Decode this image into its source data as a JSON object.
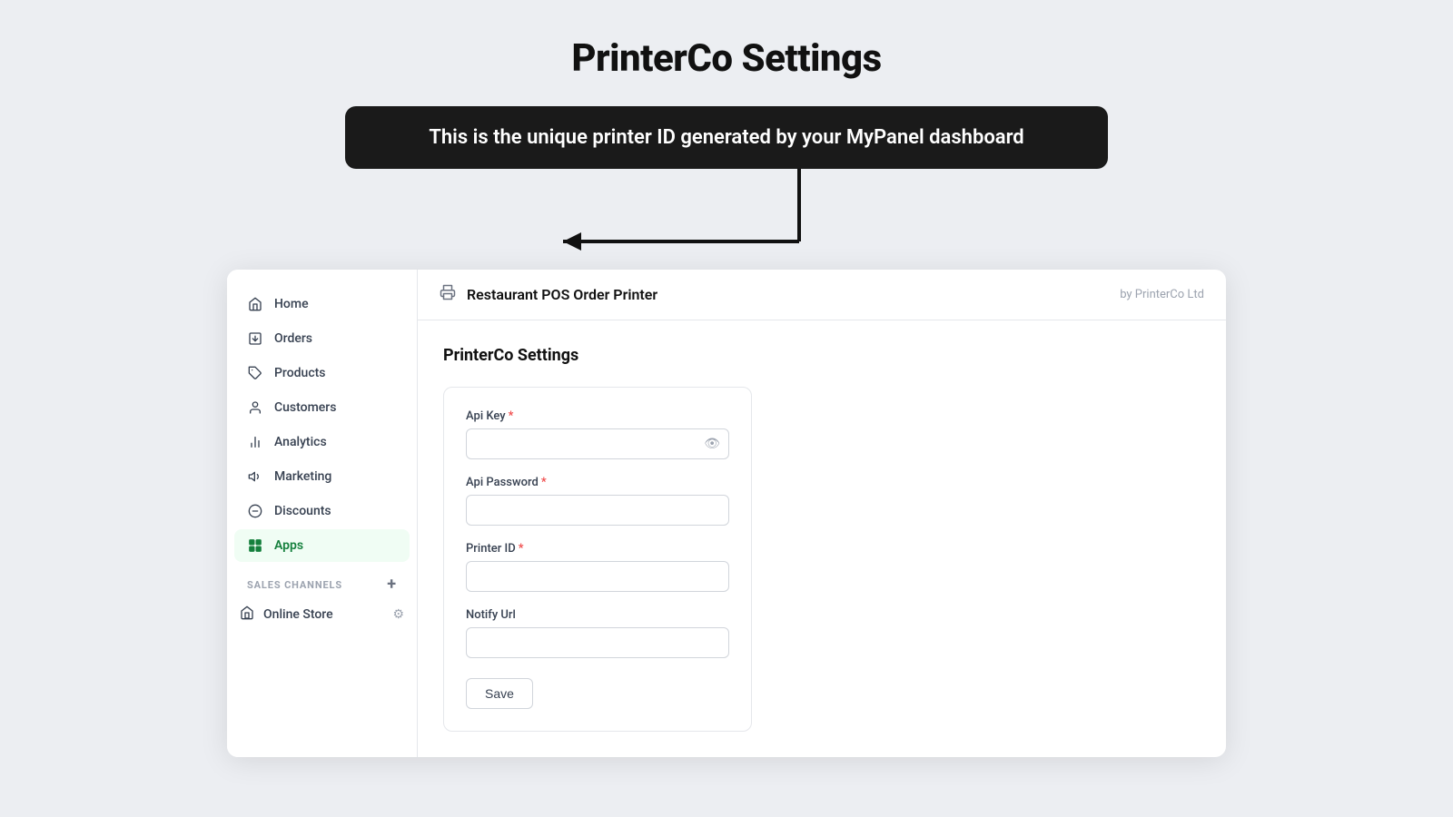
{
  "page": {
    "title": "PrinterCo Settings",
    "tooltip": "This is the unique printer ID generated by your MyPanel dashboard"
  },
  "sidebar": {
    "nav_items": [
      {
        "id": "home",
        "label": "Home",
        "icon": "home"
      },
      {
        "id": "orders",
        "label": "Orders",
        "icon": "orders"
      },
      {
        "id": "products",
        "label": "Products",
        "icon": "products"
      },
      {
        "id": "customers",
        "label": "Customers",
        "icon": "customers"
      },
      {
        "id": "analytics",
        "label": "Analytics",
        "icon": "analytics"
      },
      {
        "id": "marketing",
        "label": "Marketing",
        "icon": "marketing"
      },
      {
        "id": "discounts",
        "label": "Discounts",
        "icon": "discounts"
      },
      {
        "id": "apps",
        "label": "Apps",
        "icon": "apps",
        "active": true
      }
    ],
    "channels_label": "SALES CHANNELS",
    "channels": [
      {
        "id": "online-store",
        "label": "Online Store",
        "icon": "store"
      }
    ]
  },
  "top_bar": {
    "icon": "printer",
    "title": "Restaurant POS Order Printer",
    "by_label": "by PrinterCo Ltd"
  },
  "form": {
    "title": "PrinterCo Settings",
    "fields": [
      {
        "id": "api-key",
        "label": "Api Key",
        "required": true,
        "type": "password",
        "placeholder": ""
      },
      {
        "id": "api-password",
        "label": "Api Password",
        "required": true,
        "type": "password",
        "placeholder": ""
      },
      {
        "id": "printer-id",
        "label": "Printer ID",
        "required": true,
        "type": "text",
        "placeholder": ""
      },
      {
        "id": "notify-url",
        "label": "Notify Url",
        "required": false,
        "type": "text",
        "placeholder": ""
      }
    ],
    "save_button": "Save"
  }
}
